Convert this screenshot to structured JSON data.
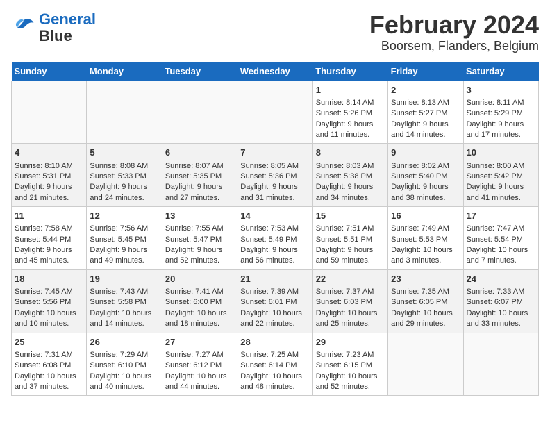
{
  "header": {
    "logo_line1": "General",
    "logo_line2": "Blue",
    "title": "February 2024",
    "subtitle": "Boorsem, Flanders, Belgium"
  },
  "days_of_week": [
    "Sunday",
    "Monday",
    "Tuesday",
    "Wednesday",
    "Thursday",
    "Friday",
    "Saturday"
  ],
  "weeks": [
    [
      {
        "day": "",
        "content": ""
      },
      {
        "day": "",
        "content": ""
      },
      {
        "day": "",
        "content": ""
      },
      {
        "day": "",
        "content": ""
      },
      {
        "day": "1",
        "content": "Sunrise: 8:14 AM\nSunset: 5:26 PM\nDaylight: 9 hours and 11 minutes."
      },
      {
        "day": "2",
        "content": "Sunrise: 8:13 AM\nSunset: 5:27 PM\nDaylight: 9 hours and 14 minutes."
      },
      {
        "day": "3",
        "content": "Sunrise: 8:11 AM\nSunset: 5:29 PM\nDaylight: 9 hours and 17 minutes."
      }
    ],
    [
      {
        "day": "4",
        "content": "Sunrise: 8:10 AM\nSunset: 5:31 PM\nDaylight: 9 hours and 21 minutes."
      },
      {
        "day": "5",
        "content": "Sunrise: 8:08 AM\nSunset: 5:33 PM\nDaylight: 9 hours and 24 minutes."
      },
      {
        "day": "6",
        "content": "Sunrise: 8:07 AM\nSunset: 5:35 PM\nDaylight: 9 hours and 27 minutes."
      },
      {
        "day": "7",
        "content": "Sunrise: 8:05 AM\nSunset: 5:36 PM\nDaylight: 9 hours and 31 minutes."
      },
      {
        "day": "8",
        "content": "Sunrise: 8:03 AM\nSunset: 5:38 PM\nDaylight: 9 hours and 34 minutes."
      },
      {
        "day": "9",
        "content": "Sunrise: 8:02 AM\nSunset: 5:40 PM\nDaylight: 9 hours and 38 minutes."
      },
      {
        "day": "10",
        "content": "Sunrise: 8:00 AM\nSunset: 5:42 PM\nDaylight: 9 hours and 41 minutes."
      }
    ],
    [
      {
        "day": "11",
        "content": "Sunrise: 7:58 AM\nSunset: 5:44 PM\nDaylight: 9 hours and 45 minutes."
      },
      {
        "day": "12",
        "content": "Sunrise: 7:56 AM\nSunset: 5:45 PM\nDaylight: 9 hours and 49 minutes."
      },
      {
        "day": "13",
        "content": "Sunrise: 7:55 AM\nSunset: 5:47 PM\nDaylight: 9 hours and 52 minutes."
      },
      {
        "day": "14",
        "content": "Sunrise: 7:53 AM\nSunset: 5:49 PM\nDaylight: 9 hours and 56 minutes."
      },
      {
        "day": "15",
        "content": "Sunrise: 7:51 AM\nSunset: 5:51 PM\nDaylight: 9 hours and 59 minutes."
      },
      {
        "day": "16",
        "content": "Sunrise: 7:49 AM\nSunset: 5:53 PM\nDaylight: 10 hours and 3 minutes."
      },
      {
        "day": "17",
        "content": "Sunrise: 7:47 AM\nSunset: 5:54 PM\nDaylight: 10 hours and 7 minutes."
      }
    ],
    [
      {
        "day": "18",
        "content": "Sunrise: 7:45 AM\nSunset: 5:56 PM\nDaylight: 10 hours and 10 minutes."
      },
      {
        "day": "19",
        "content": "Sunrise: 7:43 AM\nSunset: 5:58 PM\nDaylight: 10 hours and 14 minutes."
      },
      {
        "day": "20",
        "content": "Sunrise: 7:41 AM\nSunset: 6:00 PM\nDaylight: 10 hours and 18 minutes."
      },
      {
        "day": "21",
        "content": "Sunrise: 7:39 AM\nSunset: 6:01 PM\nDaylight: 10 hours and 22 minutes."
      },
      {
        "day": "22",
        "content": "Sunrise: 7:37 AM\nSunset: 6:03 PM\nDaylight: 10 hours and 25 minutes."
      },
      {
        "day": "23",
        "content": "Sunrise: 7:35 AM\nSunset: 6:05 PM\nDaylight: 10 hours and 29 minutes."
      },
      {
        "day": "24",
        "content": "Sunrise: 7:33 AM\nSunset: 6:07 PM\nDaylight: 10 hours and 33 minutes."
      }
    ],
    [
      {
        "day": "25",
        "content": "Sunrise: 7:31 AM\nSunset: 6:08 PM\nDaylight: 10 hours and 37 minutes."
      },
      {
        "day": "26",
        "content": "Sunrise: 7:29 AM\nSunset: 6:10 PM\nDaylight: 10 hours and 40 minutes."
      },
      {
        "day": "27",
        "content": "Sunrise: 7:27 AM\nSunset: 6:12 PM\nDaylight: 10 hours and 44 minutes."
      },
      {
        "day": "28",
        "content": "Sunrise: 7:25 AM\nSunset: 6:14 PM\nDaylight: 10 hours and 48 minutes."
      },
      {
        "day": "29",
        "content": "Sunrise: 7:23 AM\nSunset: 6:15 PM\nDaylight: 10 hours and 52 minutes."
      },
      {
        "day": "",
        "content": ""
      },
      {
        "day": "",
        "content": ""
      }
    ]
  ]
}
